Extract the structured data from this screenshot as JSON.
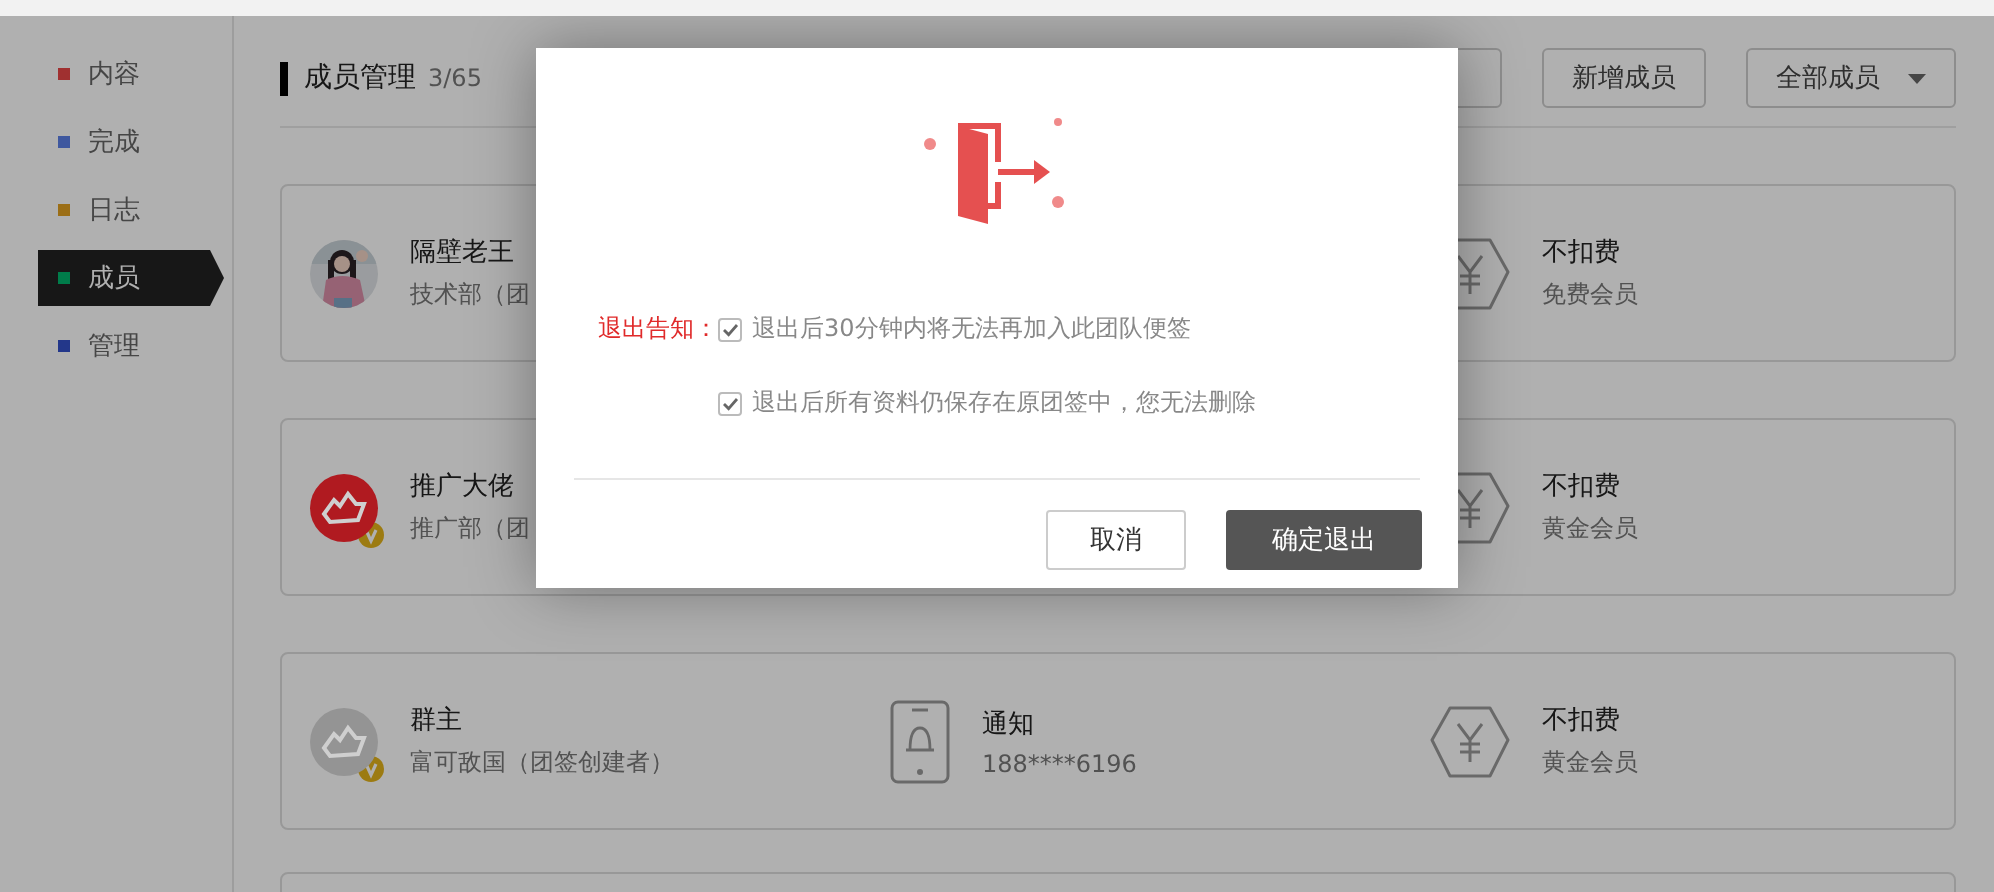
{
  "sidebar": {
    "items": [
      {
        "label": "内容",
        "color": "#a03030",
        "selected": false
      },
      {
        "label": "完成",
        "color": "#3f589f",
        "selected": false
      },
      {
        "label": "日志",
        "color": "#9b6e16",
        "selected": false
      },
      {
        "label": "成员",
        "color": "#007c4a",
        "selected": true
      },
      {
        "label": "管理",
        "color": "#23378a",
        "selected": false
      }
    ]
  },
  "header": {
    "title": "成员管理",
    "count": "3/65",
    "buttons": [
      "新增成员"
    ],
    "filter": "全部成员"
  },
  "members": [
    {
      "kind": "member",
      "verified": false,
      "name": "隔壁老王",
      "dept": "技术部（团",
      "fee": "不扣费",
      "tier": "免费会员"
    },
    {
      "kind": "member",
      "avatar": {
        "kind": "logo",
        "color": "#b01a20"
      },
      "verified": true,
      "name": "推广大佬",
      "dept": "推广部（团",
      "fee": "不扣费",
      "tier": "黄金会员"
    },
    {
      "kind": "member",
      "avatar": {
        "kind": "logo",
        "color": "#949494"
      },
      "verified": true,
      "name": "群主",
      "dept": "富可敌国（团签创建者）",
      "contact": "通知",
      "phone": "188****6196",
      "fee": "不扣费",
      "tier": "黄金会员"
    },
    {
      "kind": "blank"
    }
  ],
  "dialog": {
    "notice_label": "退出告知：",
    "notices": [
      {
        "text": "退出后30分钟内将无法再加入此团队便签",
        "checked": true
      },
      {
        "text": "退出后所有资料仍保存在原团签中，您无法删除",
        "checked": true
      }
    ],
    "buttons": [
      {
        "label": "取消",
        "kind": "secondary"
      },
      {
        "label": "确定退出",
        "kind": "primary"
      }
    ]
  }
}
